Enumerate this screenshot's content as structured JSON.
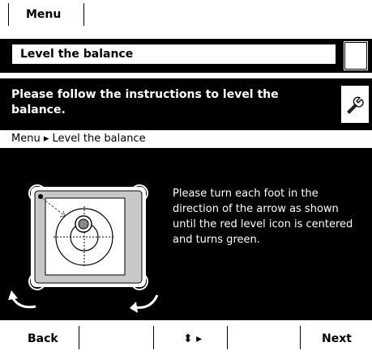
{
  "top_menu": {
    "label": "Menu"
  },
  "title_bar": {
    "title": "Level the balance"
  },
  "instruction": {
    "text": "Please follow the instructions to level the balance.",
    "icon": "wrench-icon"
  },
  "breadcrumb": {
    "text": "Menu ▸ Level the balance"
  },
  "help": {
    "text": "Please turn each foot in the direction of the arrow as shown until the red level icon is centered and turns green."
  },
  "softkeys": {
    "back": "Back",
    "nav": "⬍ ▸",
    "next": "Next"
  },
  "illustration": {
    "icon": "balance-level-diagram-icon"
  }
}
